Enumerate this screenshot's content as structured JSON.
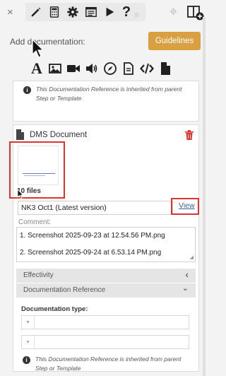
{
  "toolbar": {
    "close": "×",
    "icons": [
      "pencil-icon",
      "calculator-icon",
      "gear-icon",
      "list-form-icon",
      "play-icon",
      "help-icon",
      "drag-handle-icon",
      "move-icon",
      "add-column-icon"
    ],
    "help_glyph": "?"
  },
  "add_documentation": {
    "label": "Add documentation:",
    "guidelines_label": "Guidelines",
    "doc_type_icons": [
      "text-icon",
      "image-icon",
      "video-icon",
      "audio-icon",
      "compass-icon",
      "document-icon",
      "code-icon",
      "file-icon"
    ],
    "text_glyph": "A"
  },
  "inherited_note_top": "This Documentation Reference is inherited from parent Step or Template",
  "dms": {
    "title": "DMS Document",
    "files_count": "10 files",
    "version": "NK3 Oct1 (Latest version)",
    "view_label": "View",
    "comment_label": "Comment:",
    "comment_lines": [
      "1. Screenshot 2025-09-23 at 12.54.56 PM.png",
      "2. Screenshot 2025-09-24 at 6.53.14 PM.png"
    ],
    "effectivity_label": "Effectivity",
    "effectivity_chevron": "‹",
    "doc_ref_label": "Documentation Reference",
    "doc_ref_chevron": "⌄",
    "doc_type_label": "Documentation type:",
    "inherited_note": "This Documentation Reference is inherited from parent Step or Template"
  },
  "colors": {
    "accent": "#d9a041",
    "delete": "#d9362f",
    "highlight": "#d9362f",
    "link": "#3a5f9e"
  }
}
